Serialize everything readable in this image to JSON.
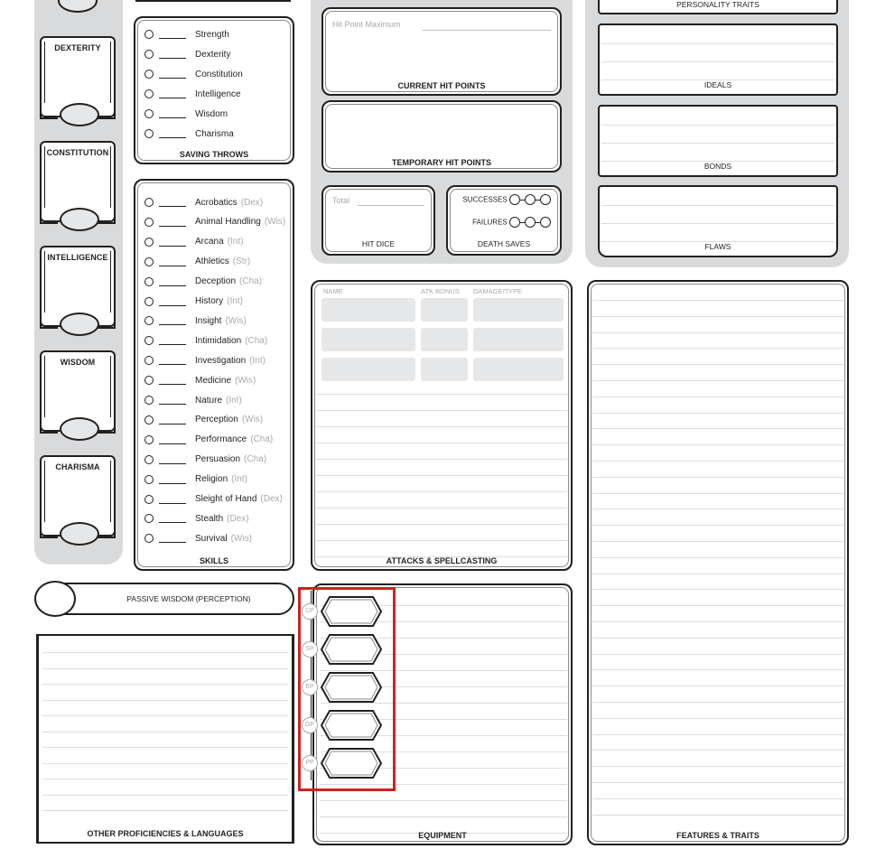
{
  "abilities": [
    {
      "label": "DEXTERITY"
    },
    {
      "label": "CONSTITUTION"
    },
    {
      "label": "INTELLIGENCE"
    },
    {
      "label": "WISDOM"
    },
    {
      "label": "CHARISMA"
    }
  ],
  "saving_throws": {
    "title": "SAVING THROWS",
    "items": [
      "Strength",
      "Dexterity",
      "Constitution",
      "Intelligence",
      "Wisdom",
      "Charisma"
    ]
  },
  "skills": {
    "title": "SKILLS",
    "items": [
      {
        "name": "Acrobatics",
        "ability": "(Dex)"
      },
      {
        "name": "Animal Handling",
        "ability": "(Wis)"
      },
      {
        "name": "Arcana",
        "ability": "(Int)"
      },
      {
        "name": "Athletics",
        "ability": "(Str)"
      },
      {
        "name": "Deception",
        "ability": "(Cha)"
      },
      {
        "name": "History",
        "ability": "(Int)"
      },
      {
        "name": "Insight",
        "ability": "(Wis)"
      },
      {
        "name": "Intimidation",
        "ability": "(Cha)"
      },
      {
        "name": "Investigation",
        "ability": "(Int)"
      },
      {
        "name": "Medicine",
        "ability": "(Wis)"
      },
      {
        "name": "Nature",
        "ability": "(Int)"
      },
      {
        "name": "Perception",
        "ability": "(Wis)"
      },
      {
        "name": "Performance",
        "ability": "(Cha)"
      },
      {
        "name": "Persuasion",
        "ability": "(Cha)"
      },
      {
        "name": "Religion",
        "ability": "(Int)"
      },
      {
        "name": "Sleight of Hand",
        "ability": "(Dex)"
      },
      {
        "name": "Stealth",
        "ability": "(Dex)"
      },
      {
        "name": "Survival",
        "ability": "(Wis)"
      }
    ]
  },
  "hit_points": {
    "max_label": "Hit Point Maximum",
    "current_title": "CURRENT HIT POINTS",
    "temp_title": "TEMPORARY HIT POINTS"
  },
  "hit_dice": {
    "total_label": "Total",
    "title": "HIT DICE"
  },
  "death_saves": {
    "successes_label": "SUCCESSES",
    "failures_label": "FAILURES",
    "title": "DEATH SAVES"
  },
  "personality": {
    "traits_title": "PERSONALITY TRAITS",
    "ideals_title": "IDEALS",
    "bonds_title": "BONDS",
    "flaws_title": "FLAWS"
  },
  "attacks": {
    "headers": [
      "NAME",
      "ATK BONUS",
      "DAMAGE/TYPE"
    ],
    "title": "ATTACKS & SPELLCASTING"
  },
  "passive_wisdom": {
    "label": "PASSIVE WISDOM (PERCEPTION)"
  },
  "other_proficiencies": {
    "title": "OTHER PROFICIENCIES & LANGUAGES"
  },
  "equipment": {
    "title": "EQUIPMENT",
    "coins": [
      "CP",
      "SP",
      "EP",
      "GP",
      "PP"
    ]
  },
  "features": {
    "title": "FEATURES & TRAITS"
  },
  "colors": {
    "ink": "#231f20",
    "panel_gray": "#d9dadb",
    "field_gray": "#e6e7e8",
    "faint_text": "#a7a9ac",
    "highlight_red": "#d21f1f"
  }
}
